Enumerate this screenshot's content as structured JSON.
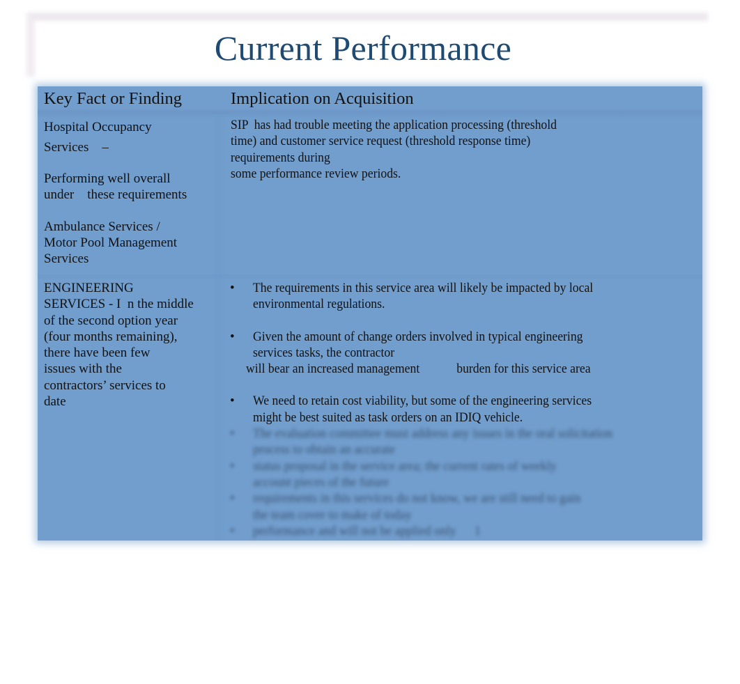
{
  "slide": {
    "title": "Current Performance"
  },
  "table": {
    "headers": [
      "Key Fact or Finding",
      "Implication on Acquisition"
    ],
    "row1": {
      "finding": {
        "line1": "Hospital Occupancy",
        "line2": "Services    –",
        "line3": "Performing well overall",
        "line4": "under    these requirements",
        "line5": "Ambulance Services /",
        "line6": "Motor Pool Management",
        "line7": "Services"
      },
      "implication": {
        "line1": "SIP  has had trouble meeting the application processing (threshold",
        "line2": "time) and customer service request (threshold response time)",
        "line3": "requirements during",
        "line4": "some performance review periods."
      }
    },
    "row2": {
      "finding": {
        "line1": "ENGINEERING",
        "line2": "SERVICES - I  n the middle",
        "line3": "of the second option year",
        "line4": "(four months remaining),",
        "line5": "there have been few",
        "line6": "issues with the",
        "line7": "contractors’ services to",
        "line8": "date"
      },
      "bullet_glyph": "•",
      "bullets": [
        {
          "line1": "The requirements in this service area will likely be impacted by local",
          "line2": "environmental regulations."
        },
        {
          "line1": "Given the amount of change orders involved in typical engineering",
          "line2": "services tasks, the contractor",
          "line3": "will bear an increased management            burden for this service area"
        },
        {
          "line1": "We need to retain cost viability, but some of the engineering services",
          "line2": "might be best suited as task orders on an IDIQ vehicle."
        }
      ],
      "obscured_bullets": [
        {
          "line1": "The evaluation committee must address any issues in the oral solicitation",
          "line2": "process to obtain an accurate"
        },
        {
          "line1": "status proposal in the service area; the current rates of weekly",
          "line2": "account pieces of the future"
        },
        {
          "line1": "requirements in this services do not know, we are still need to gain",
          "line2": "the team cover to make of today"
        },
        {
          "line1": "performance and will not be applied only      1"
        }
      ]
    }
  },
  "colors": {
    "title": "#1f4a72",
    "table_background": "#729ece",
    "text": "#111111"
  }
}
